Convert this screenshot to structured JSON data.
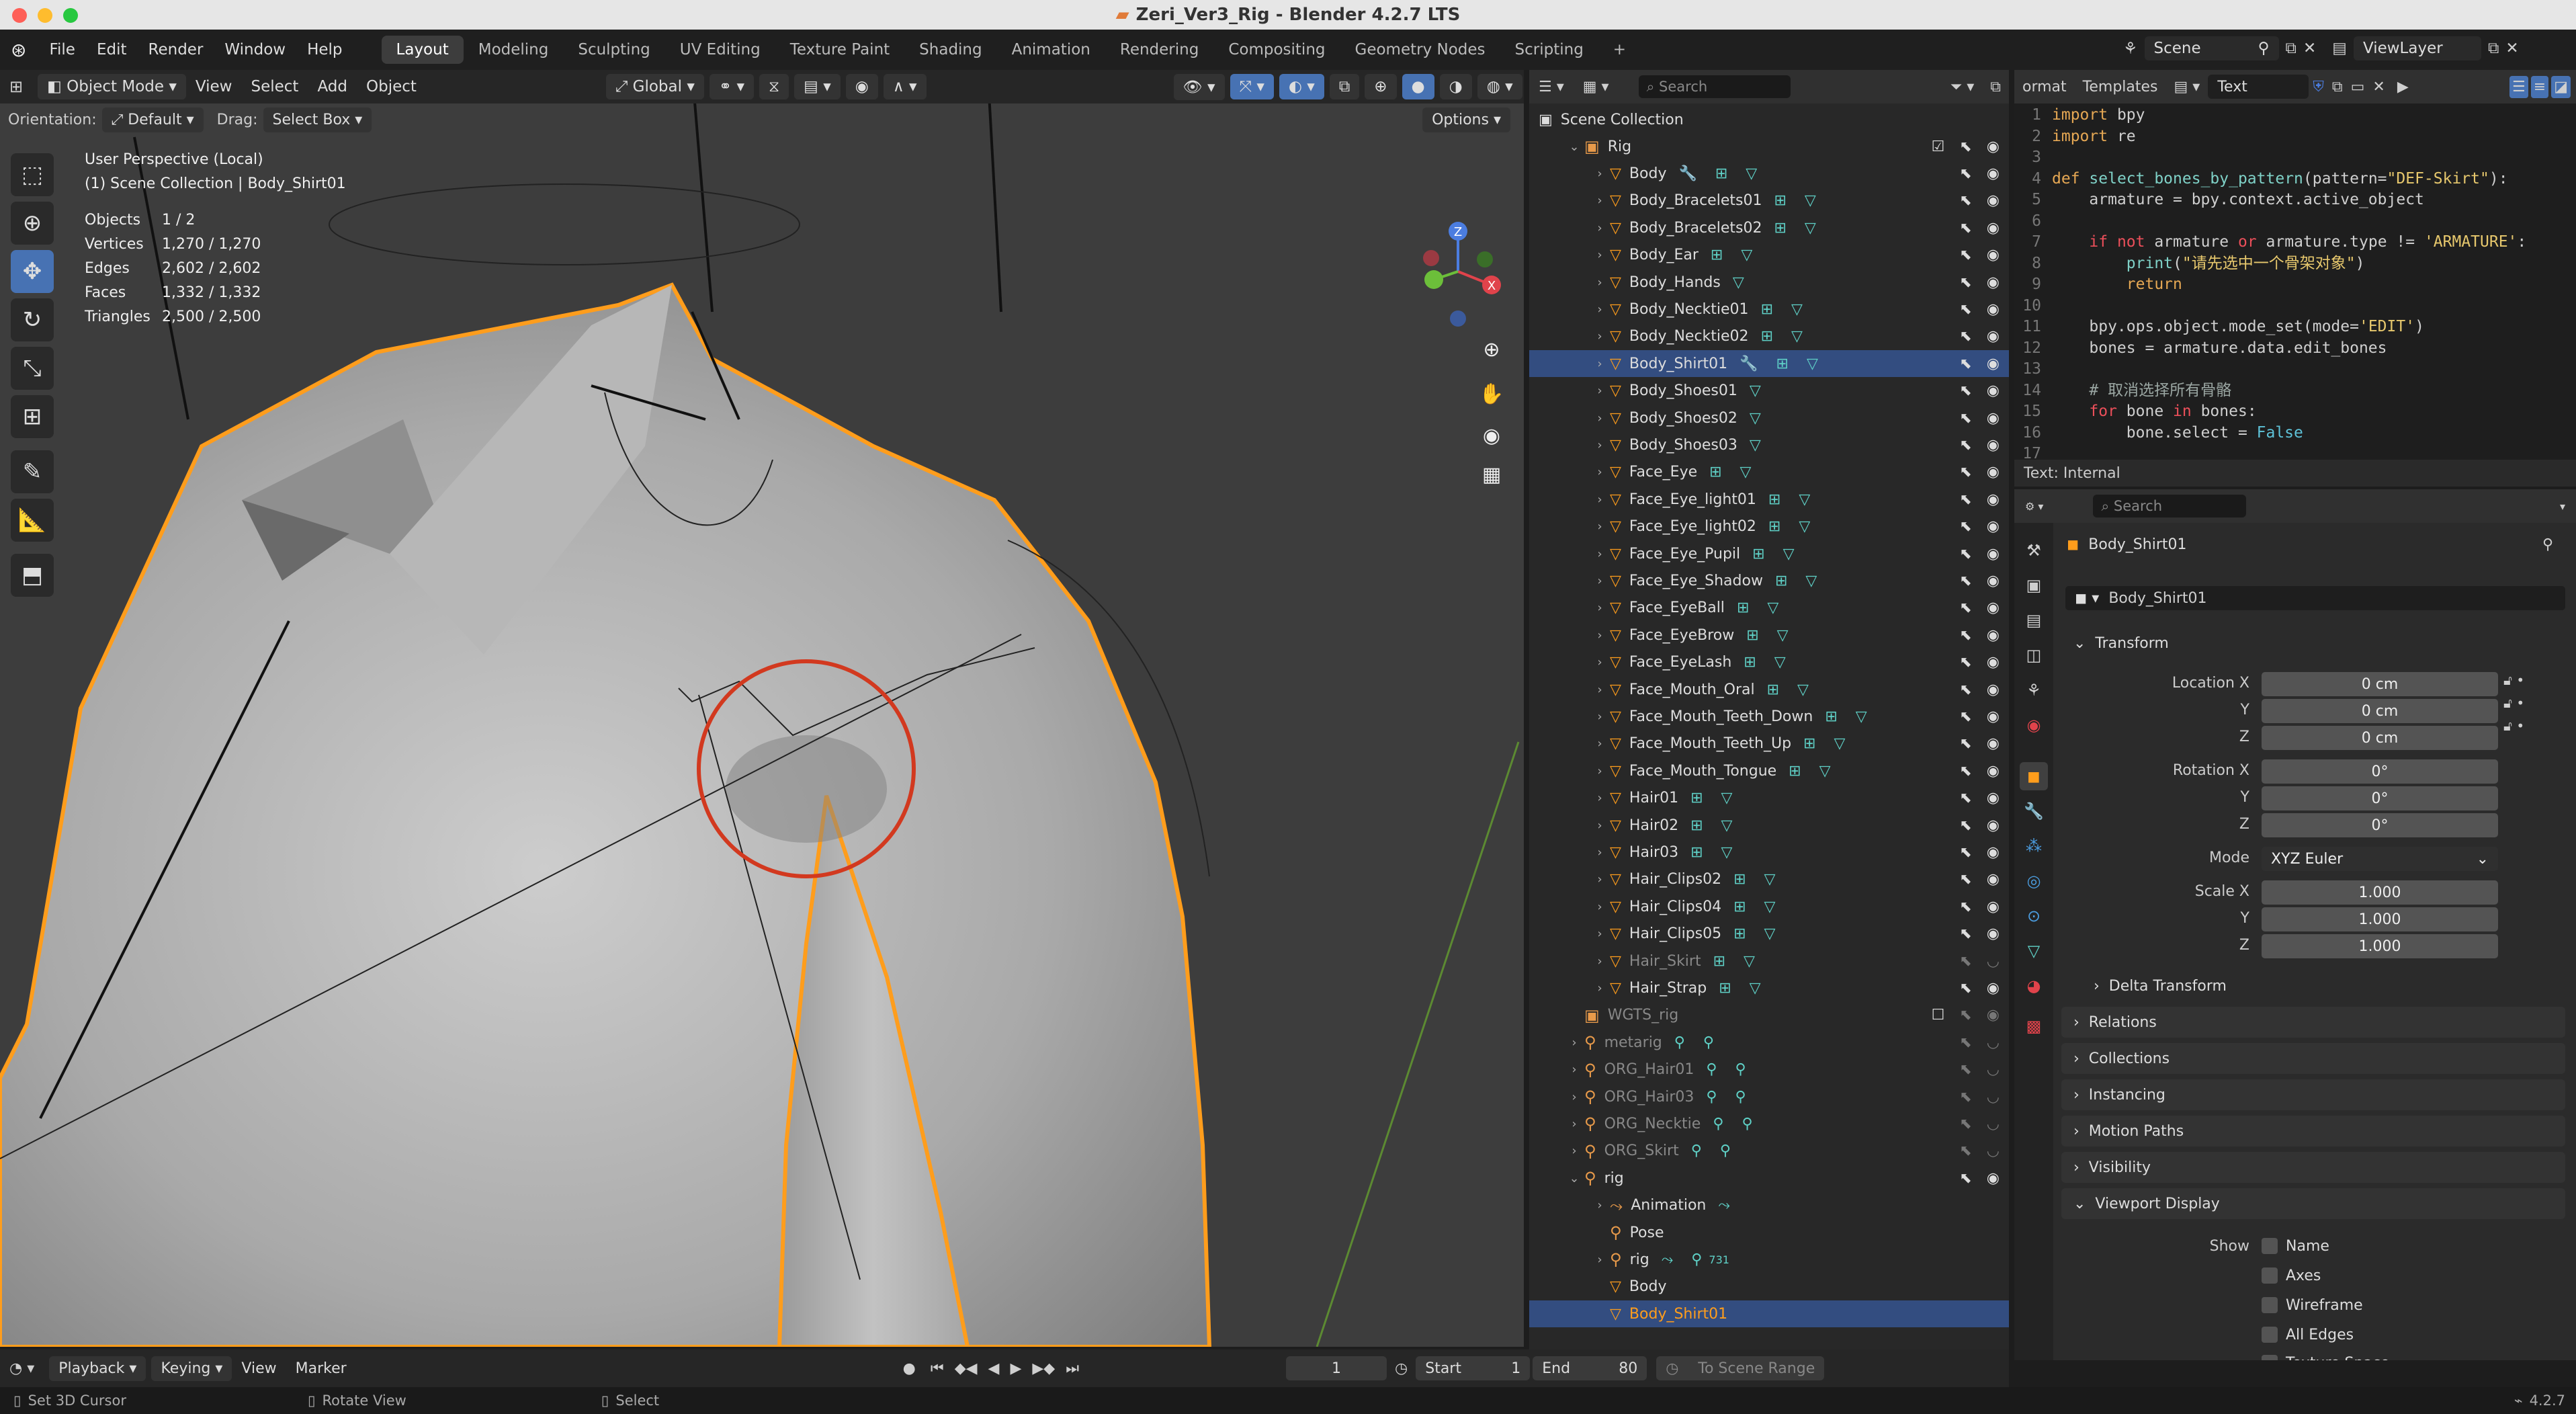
{
  "window": {
    "title": "Zeri_Ver3_Rig - Blender 4.2.7 LTS"
  },
  "menu": [
    "File",
    "Edit",
    "Render",
    "Window",
    "Help"
  ],
  "workspaces": [
    "Layout",
    "Modeling",
    "Sculpting",
    "UV Editing",
    "Texture Paint",
    "Shading",
    "Animation",
    "Rendering",
    "Compositing",
    "Geometry Nodes",
    "Scripting"
  ],
  "scene": {
    "name": "Scene",
    "view_layer": "ViewLayer"
  },
  "viewport": {
    "mode": "Object Mode",
    "menus": [
      "View",
      "Select",
      "Add",
      "Object"
    ],
    "transform_orientation": "Global",
    "orientation_label": "Orientation:",
    "orientation_value": "Default",
    "drag_label": "Drag:",
    "drag_value": "Select Box",
    "options": "Options",
    "perspective": "User Perspective (Local)",
    "collection_path": "(1) Scene Collection | Body_Shirt01",
    "stats": [
      {
        "label": "Objects",
        "value": "1 / 2"
      },
      {
        "label": "Vertices",
        "value": "1,270 / 1,270"
      },
      {
        "label": "Edges",
        "value": "2,602 / 2,602"
      },
      {
        "label": "Faces",
        "value": "1,332 / 1,332"
      },
      {
        "label": "Triangles",
        "value": "2,500 / 2,500"
      }
    ],
    "gizmo": {
      "x": "X",
      "y": "Y",
      "z": "Z"
    }
  },
  "outliner": {
    "search_placeholder": "Search",
    "root": "Scene Collection",
    "rows": [
      {
        "name": "Rig",
        "kind": "collection"
      },
      {
        "name": "Body",
        "kind": "mesh"
      },
      {
        "name": "Body_Bracelets01",
        "kind": "mesh"
      },
      {
        "name": "Body_Bracelets02",
        "kind": "mesh"
      },
      {
        "name": "Body_Ear",
        "kind": "mesh"
      },
      {
        "name": "Body_Hands",
        "kind": "mesh"
      },
      {
        "name": "Body_Necktie01",
        "kind": "mesh"
      },
      {
        "name": "Body_Necktie02",
        "kind": "mesh"
      },
      {
        "name": "Body_Shirt01",
        "kind": "mesh"
      },
      {
        "name": "Body_Shoes01",
        "kind": "mesh"
      },
      {
        "name": "Body_Shoes02",
        "kind": "mesh"
      },
      {
        "name": "Body_Shoes03",
        "kind": "mesh"
      },
      {
        "name": "Face_Eye",
        "kind": "mesh"
      },
      {
        "name": "Face_Eye_light01",
        "kind": "mesh"
      },
      {
        "name": "Face_Eye_light02",
        "kind": "mesh"
      },
      {
        "name": "Face_Eye_Pupil",
        "kind": "mesh"
      },
      {
        "name": "Face_Eye_Shadow",
        "kind": "mesh"
      },
      {
        "name": "Face_EyeBall",
        "kind": "mesh"
      },
      {
        "name": "Face_EyeBrow",
        "kind": "mesh"
      },
      {
        "name": "Face_EyeLash",
        "kind": "mesh"
      },
      {
        "name": "Face_Mouth_Oral",
        "kind": "mesh"
      },
      {
        "name": "Face_Mouth_Teeth_Down",
        "kind": "mesh"
      },
      {
        "name": "Face_Mouth_Teeth_Up",
        "kind": "mesh"
      },
      {
        "name": "Face_Mouth_Tongue",
        "kind": "mesh"
      },
      {
        "name": "Hair01",
        "kind": "mesh"
      },
      {
        "name": "Hair02",
        "kind": "mesh"
      },
      {
        "name": "Hair03",
        "kind": "mesh"
      },
      {
        "name": "Hair_Clips02",
        "kind": "mesh"
      },
      {
        "name": "Hair_Clips04",
        "kind": "mesh"
      },
      {
        "name": "Hair_Clips05",
        "kind": "mesh"
      },
      {
        "name": "Hair_Skirt",
        "kind": "mesh"
      },
      {
        "name": "Hair_Strap",
        "kind": "mesh"
      },
      {
        "name": "WGTS_rig",
        "kind": "collection"
      },
      {
        "name": "metarig",
        "kind": "armature"
      },
      {
        "name": "ORG_Hair01",
        "kind": "armature"
      },
      {
        "name": "ORG_Hair03",
        "kind": "armature"
      },
      {
        "name": "ORG_Necktie",
        "kind": "armature"
      },
      {
        "name": "ORG_Skirt",
        "kind": "armature"
      },
      {
        "name": "rig",
        "kind": "armature"
      },
      {
        "name": "Animation",
        "kind": "anim"
      },
      {
        "name": "Pose",
        "kind": "pose"
      },
      {
        "name": "rig",
        "kind": "armature"
      },
      {
        "name": "Body",
        "kind": "mesh"
      },
      {
        "name": "Body_Shirt01",
        "kind": "mesh"
      }
    ],
    "rig_count": "731"
  },
  "text_editor": {
    "menu_partial": "ormat",
    "templates": "Templates",
    "datablock": "Text",
    "status": "Text: Internal",
    "lines": [
      "import bpy",
      "import re",
      "",
      "def select_bones_by_pattern(pattern=\"DEF-Skirt\"):",
      "    armature = bpy.context.active_object",
      "",
      "    if not armature or armature.type != 'ARMATURE':",
      "        print(\"请先选中一个骨架对象\")",
      "        return",
      "",
      "    bpy.ops.object.mode_set(mode='EDIT')",
      "    bones = armature.data.edit_bones",
      "",
      "    # 取消选择所有骨骼",
      "    for bone in bones:",
      "        bone.select = False",
      ""
    ]
  },
  "properties": {
    "search_placeholder": "Search",
    "object_name": "Body_Shirt01",
    "transform": "Transform",
    "location_label": "Location X",
    "location": [
      "0 cm",
      "0 cm",
      "0 cm"
    ],
    "rotation_label": "Rotation X",
    "rotation": [
      "0°",
      "0°",
      "0°"
    ],
    "mode_label": "Mode",
    "mode": "XYZ Euler",
    "scale_label": "Scale X",
    "scale": [
      "1.000",
      "1.000",
      "1.000"
    ],
    "y": "Y",
    "z": "Z",
    "delta": "Delta Transform",
    "sections": [
      "Relations",
      "Collections",
      "Instancing",
      "Motion Paths",
      "Visibility",
      "Viewport Display"
    ],
    "show_label": "Show",
    "show_options": [
      "Name",
      "Axes",
      "Wireframe",
      "All Edges",
      "Texture Space"
    ]
  },
  "timeline": {
    "menus": [
      "Playback",
      "Keying",
      "View",
      "Marker"
    ],
    "current_frame": "1",
    "start_label": "Start",
    "start": "1",
    "end_label": "End",
    "end": "80",
    "to_scene_range": "To Scene Range"
  },
  "statusbar": {
    "hints": [
      "Set 3D Cursor",
      "Rotate View",
      "Select"
    ],
    "version": "4.2.7"
  }
}
